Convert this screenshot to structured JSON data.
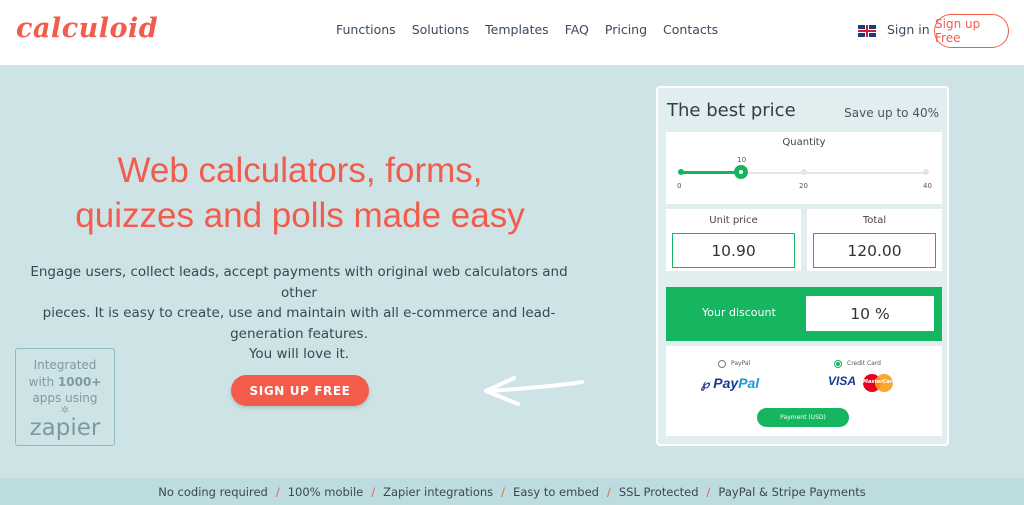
{
  "header": {
    "logo": "calculoid",
    "nav": [
      "Functions",
      "Solutions",
      "Templates",
      "FAQ",
      "Pricing",
      "Contacts"
    ],
    "language_icon": "uk-flag-icon",
    "signin": "Sign in",
    "signup": "Sign up Free"
  },
  "hero": {
    "title_line1": "Web calculators, forms,",
    "title_line2": "quizzes and polls made easy",
    "description_lines": [
      "Engage users, collect leads, accept payments with original web calculators and other",
      "pieces. It is easy to create, use and maintain with all e-commerce and lead-",
      "generation features.",
      "You will love it."
    ],
    "cta": "SIGN UP FREE",
    "zapier": {
      "line1": "Integrated",
      "line2_pre": "with ",
      "line2_bold": "1000+",
      "line3": "apps using",
      "star": "✲",
      "word": "zapier"
    },
    "arrow_icon": "hand-drawn-arrow-left-icon"
  },
  "widget": {
    "title": "The best price",
    "save": "Save up to 40%",
    "quantity": {
      "label": "Quantity",
      "value": 10,
      "value_label": "10",
      "min": 0,
      "max": 40,
      "ticks": [
        "0",
        "20",
        "40"
      ]
    },
    "unit_price": {
      "label": "Unit price",
      "value": "10.90"
    },
    "total": {
      "label": "Total",
      "value": "120.00"
    },
    "discount": {
      "label": "Your discount",
      "value": "10 %"
    },
    "payment": {
      "options": [
        {
          "label": "PayPal",
          "selected": false
        },
        {
          "label": "Credit Card",
          "selected": true
        }
      ],
      "paypal_logo_1": "Pay",
      "paypal_logo_2": "Pal",
      "paypal_icon": "paypal-icon",
      "visa_logo": "VISA",
      "mastercard_logo": "MasterCard",
      "button": "Payment (USD)"
    }
  },
  "features": [
    "No coding required",
    "100% mobile",
    "Zapier integrations",
    "Easy to embed",
    "SSL Protected",
    "PayPal & Stripe Payments"
  ],
  "features_separator": "/",
  "colors": {
    "brand": "#f35b4b",
    "green": "#16b560",
    "background": "#cde3e6"
  }
}
